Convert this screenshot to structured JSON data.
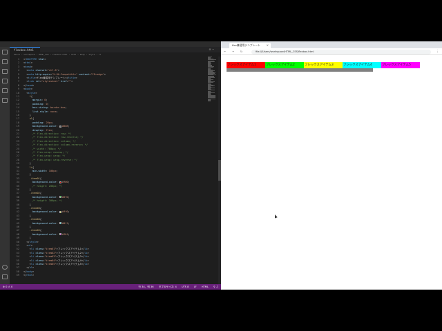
{
  "vscode": {
    "tab_label": "flexbox.html",
    "tab_actions": "⊟ ⋯",
    "breadcrumb": "Users › workspace › HTML_CSS › flexbox.html › html › body › style › li",
    "code_lines": [
      {
        "n": "1",
        "t": [
          [
            "t-pl",
            "<!"
          ],
          [
            "t-tag",
            "DOCTYPE"
          ],
          [
            "t-pl",
            " "
          ],
          [
            "t-attr",
            "html"
          ],
          [
            "t-pl",
            ">"
          ]
        ]
      },
      {
        "n": "2",
        "t": [
          [
            "t-pl",
            "<"
          ],
          [
            "t-tag",
            "html"
          ],
          [
            "t-pl",
            ">"
          ]
        ]
      },
      {
        "n": "3",
        "t": [
          [
            "t-pl",
            "<"
          ],
          [
            "t-tag",
            "head"
          ],
          [
            "t-pl",
            ">"
          ]
        ]
      },
      {
        "n": "4",
        "t": [
          [
            "t-pl",
            "  <"
          ],
          [
            "t-tag",
            "meta"
          ],
          [
            "t-pl",
            " "
          ],
          [
            "t-attr",
            "charset"
          ],
          [
            "t-pl",
            "="
          ],
          [
            "t-str",
            "\"utf-8\""
          ],
          [
            "t-pl",
            ">"
          ]
        ]
      },
      {
        "n": "5",
        "t": [
          [
            "t-pl",
            "  <"
          ],
          [
            "t-tag",
            "meta"
          ],
          [
            "t-pl",
            " "
          ],
          [
            "t-attr",
            "http-equiv"
          ],
          [
            "t-pl",
            "="
          ],
          [
            "t-str",
            "\"X-UA-Compatible\""
          ],
          [
            "t-pl",
            " "
          ],
          [
            "t-attr",
            "content"
          ],
          [
            "t-pl",
            "="
          ],
          [
            "t-str",
            "\"IE=edge\""
          ],
          [
            "t-pl",
            ">"
          ]
        ]
      },
      {
        "n": "6",
        "t": [
          [
            "t-pl",
            "  <"
          ],
          [
            "t-tag",
            "title"
          ],
          [
            "t-pl",
            ">flex練習用テンプレート</"
          ],
          [
            "t-tag",
            "title"
          ],
          [
            "t-pl",
            ">"
          ]
        ]
      },
      {
        "n": "7",
        "t": [
          [
            "t-pl",
            "  <"
          ],
          [
            "t-tag",
            "link"
          ],
          [
            "t-pl",
            " "
          ],
          [
            "t-attr",
            "rel"
          ],
          [
            "t-pl",
            "="
          ],
          [
            "t-str",
            "\"stylesheet\""
          ],
          [
            "t-pl",
            " "
          ],
          [
            "t-attr",
            "href"
          ],
          [
            "t-pl",
            "="
          ],
          [
            "t-str",
            "\"\""
          ],
          [
            "t-pl",
            ">"
          ]
        ]
      },
      {
        "n": "8",
        "t": [
          [
            "t-pl",
            "</"
          ],
          [
            "t-tag",
            "head"
          ],
          [
            "t-pl",
            ">"
          ]
        ]
      },
      {
        "n": "9",
        "t": [
          [
            "t-pl",
            "<"
          ],
          [
            "t-tag",
            "body"
          ],
          [
            "t-pl",
            ">"
          ]
        ]
      },
      {
        "n": "10",
        "t": [
          [
            "t-pl",
            "  <"
          ],
          [
            "t-tag",
            "style"
          ],
          [
            "t-pl",
            ">"
          ]
        ]
      },
      {
        "n": "11",
        "t": [
          [
            "t-sel",
            "    *"
          ],
          [
            "t-pl",
            "{"
          ]
        ]
      },
      {
        "n": "12",
        "t": [
          [
            "t-prop",
            "      margin"
          ],
          [
            "t-pl",
            ": "
          ],
          [
            "t-val",
            "0"
          ],
          [
            "t-pl",
            ";"
          ]
        ]
      },
      {
        "n": "13",
        "t": [
          [
            "t-prop",
            "      padding"
          ],
          [
            "t-pl",
            ": "
          ],
          [
            "t-val",
            "0"
          ],
          [
            "t-pl",
            ";"
          ]
        ]
      },
      {
        "n": "14",
        "t": [
          [
            "t-prop",
            "      box-sizing"
          ],
          [
            "t-pl",
            ": "
          ],
          [
            "t-val",
            "border-box"
          ],
          [
            "t-pl",
            ";"
          ]
        ]
      },
      {
        "n": "15",
        "t": [
          [
            "t-prop",
            "      list-style"
          ],
          [
            "t-pl",
            ": "
          ],
          [
            "t-val",
            "none"
          ],
          [
            "t-pl",
            ";"
          ]
        ]
      },
      {
        "n": "16",
        "t": [
          [
            "t-pl",
            "    }"
          ]
        ]
      },
      {
        "n": "17",
        "t": [
          [
            "t-sel",
            "    ul"
          ],
          [
            "t-pl",
            "{"
          ]
        ]
      },
      {
        "n": "18",
        "t": [
          [
            "t-prop",
            "      padding"
          ],
          [
            "t-pl",
            ": "
          ],
          [
            "t-val",
            "20px"
          ],
          [
            "t-pl",
            ";"
          ]
        ]
      },
      {
        "n": "19",
        "t": [
          [
            "t-prop",
            "      background-color"
          ],
          [
            "t-pl",
            ": "
          ],
          [
            "sw",
            "#808080"
          ],
          [
            "t-val",
            "#808"
          ],
          [
            "t-pl",
            ";"
          ]
        ]
      },
      {
        "n": "20",
        "t": [
          [
            "t-prop",
            "      display"
          ],
          [
            "t-pl",
            ": "
          ],
          [
            "t-val",
            "flex"
          ],
          [
            "t-pl",
            ";"
          ]
        ]
      },
      {
        "n": "21",
        "t": [
          [
            "t-com",
            "      /* flex-direction: row; */"
          ]
        ]
      },
      {
        "n": "22",
        "t": [
          [
            "t-com",
            "      /* flex-direction: row-reverse; */"
          ]
        ]
      },
      {
        "n": "23",
        "t": [
          [
            "t-com",
            "      /* flex-direction: column; */"
          ]
        ]
      },
      {
        "n": "24",
        "t": [
          [
            "t-com",
            "      /* flex-direction: column-reverse; */"
          ]
        ]
      },
      {
        "n": "25",
        "t": [
          [
            "t-com",
            "      /* width: 700px; */"
          ]
        ]
      },
      {
        "n": "26",
        "t": [
          [
            "t-com",
            "      /* flex-wrap: nowrap; */"
          ]
        ]
      },
      {
        "n": "27",
        "t": [
          [
            "t-com",
            "      /* flex-wrap: wrap; */"
          ]
        ]
      },
      {
        "n": "28",
        "t": [
          [
            "t-com",
            "      /* flex-wrap: wrap-reverse; */"
          ]
        ]
      },
      {
        "n": "29",
        "t": [
          [
            "t-pl",
            "    }"
          ]
        ]
      },
      {
        "n": "30",
        "t": [
          [
            "t-sel",
            "    li"
          ],
          [
            "t-pl",
            "{"
          ]
        ]
      },
      {
        "n": "31",
        "t": [
          [
            "t-prop",
            "      min-width"
          ],
          [
            "t-pl",
            ": "
          ],
          [
            "t-val",
            "100px"
          ],
          [
            "t-pl",
            ";"
          ]
        ]
      },
      {
        "n": "32",
        "t": [
          [
            "t-pl",
            "    }"
          ]
        ]
      },
      {
        "n": "33",
        "t": [
          [
            "t-sel",
            "    .item01"
          ],
          [
            "t-pl",
            "{"
          ]
        ]
      },
      {
        "n": "34",
        "t": [
          [
            "t-prop",
            "      background-color"
          ],
          [
            "t-pl",
            ": "
          ],
          [
            "sw",
            "#ff0000"
          ],
          [
            "t-val",
            "#f00"
          ],
          [
            "t-pl",
            ";"
          ]
        ]
      },
      {
        "n": "35",
        "t": [
          [
            "t-com",
            "      /* height: 200px; */"
          ]
        ]
      },
      {
        "n": "36",
        "t": [
          [
            "t-pl",
            "    }"
          ]
        ]
      },
      {
        "n": "37",
        "t": [
          [
            "t-sel",
            "    .item02"
          ],
          [
            "t-pl",
            "{"
          ]
        ]
      },
      {
        "n": "38",
        "t": [
          [
            "t-prop",
            "      background-color"
          ],
          [
            "t-pl",
            ": "
          ],
          [
            "sw",
            "#00ff00"
          ],
          [
            "t-val",
            "#0f0"
          ],
          [
            "t-pl",
            ";"
          ]
        ]
      },
      {
        "n": "39",
        "t": [
          [
            "t-com",
            "      /* height: 300px; */"
          ]
        ]
      },
      {
        "n": "40",
        "t": [
          [
            "t-pl",
            "    }"
          ]
        ]
      },
      {
        "n": "41",
        "t": [
          [
            "t-sel",
            "    .item03"
          ],
          [
            "t-pl",
            "{"
          ]
        ]
      },
      {
        "n": "42",
        "t": [
          [
            "t-prop",
            "      background-color"
          ],
          [
            "t-pl",
            ": "
          ],
          [
            "sw",
            "#ffff00"
          ],
          [
            "t-val",
            "#ff0"
          ],
          [
            "t-pl",
            ";"
          ]
        ]
      },
      {
        "n": "43",
        "t": [
          [
            "t-pl",
            "    }"
          ]
        ]
      },
      {
        "n": "44",
        "t": [
          [
            "t-sel",
            "    .item04"
          ],
          [
            "t-pl",
            "{"
          ]
        ]
      },
      {
        "n": "45",
        "t": [
          [
            "t-prop",
            "      background-color"
          ],
          [
            "t-pl",
            ": "
          ],
          [
            "sw",
            "#00ffff"
          ],
          [
            "t-val",
            "#0ff"
          ],
          [
            "t-pl",
            ";"
          ]
        ]
      },
      {
        "n": "46",
        "t": [
          [
            "t-pl",
            "    }"
          ]
        ]
      },
      {
        "n": "47",
        "t": [
          [
            "t-sel",
            "    .item05"
          ],
          [
            "t-pl",
            "{"
          ]
        ]
      },
      {
        "n": "48",
        "t": [
          [
            "t-prop",
            "      background-color"
          ],
          [
            "t-pl",
            ": "
          ],
          [
            "sw",
            "#ff00ff"
          ],
          [
            "t-val",
            "#f0f"
          ],
          [
            "t-pl",
            ";"
          ]
        ]
      },
      {
        "n": "49",
        "t": [
          [
            "t-pl",
            "    }"
          ]
        ]
      },
      {
        "n": "50",
        "t": [
          [
            "t-pl",
            "  </"
          ],
          [
            "t-tag",
            "style"
          ],
          [
            "t-pl",
            ">"
          ]
        ]
      },
      {
        "n": "51",
        "t": [
          [
            "t-pl",
            "  <"
          ],
          [
            "t-tag",
            "ul"
          ],
          [
            "t-pl",
            ">"
          ]
        ]
      },
      {
        "n": "52",
        "t": [
          [
            "t-pl",
            "    <"
          ],
          [
            "t-tag",
            "li"
          ],
          [
            "t-pl",
            " "
          ],
          [
            "t-attr",
            "class"
          ],
          [
            "t-pl",
            "="
          ],
          [
            "t-str",
            "\"item01\""
          ],
          [
            "t-pl",
            ">フレックスアイテム1</"
          ],
          [
            "t-tag",
            "li"
          ],
          [
            "t-pl",
            ">"
          ]
        ]
      },
      {
        "n": "53",
        "t": [
          [
            "t-pl",
            "    <"
          ],
          [
            "t-tag",
            "li"
          ],
          [
            "t-pl",
            " "
          ],
          [
            "t-attr",
            "class"
          ],
          [
            "t-pl",
            "="
          ],
          [
            "t-str",
            "\"item02\""
          ],
          [
            "t-pl",
            ">フレックスアイテム2</"
          ],
          [
            "t-tag",
            "li"
          ],
          [
            "t-pl",
            ">"
          ]
        ]
      },
      {
        "n": "54",
        "t": [
          [
            "t-pl",
            "    <"
          ],
          [
            "t-tag",
            "li"
          ],
          [
            "t-pl",
            " "
          ],
          [
            "t-attr",
            "class"
          ],
          [
            "t-pl",
            "="
          ],
          [
            "t-str",
            "\"item03\""
          ],
          [
            "t-pl",
            ">フレックスアイテム3</"
          ],
          [
            "t-tag",
            "li"
          ],
          [
            "t-pl",
            ">"
          ]
        ]
      },
      {
        "n": "55",
        "t": [
          [
            "t-pl",
            "    <"
          ],
          [
            "t-tag",
            "li"
          ],
          [
            "t-pl",
            " "
          ],
          [
            "t-attr",
            "class"
          ],
          [
            "t-pl",
            "="
          ],
          [
            "t-str",
            "\"item04\""
          ],
          [
            "t-pl",
            ">フレックスアイテム4</"
          ],
          [
            "t-tag",
            "li"
          ],
          [
            "t-pl",
            ">"
          ]
        ]
      },
      {
        "n": "56",
        "t": [
          [
            "t-pl",
            "    <"
          ],
          [
            "t-tag",
            "li"
          ],
          [
            "t-pl",
            " "
          ],
          [
            "t-attr",
            "class"
          ],
          [
            "t-pl",
            "="
          ],
          [
            "t-str",
            "\"item05\""
          ],
          [
            "t-pl",
            ">フレックスアイテム5</"
          ],
          [
            "t-tag",
            "li"
          ],
          [
            "t-pl",
            ">"
          ]
        ]
      },
      {
        "n": "57",
        "t": [
          [
            "t-pl",
            "  </"
          ],
          [
            "t-tag",
            "ul"
          ],
          [
            "t-pl",
            ">"
          ]
        ]
      },
      {
        "n": "58",
        "t": [
          [
            "t-pl",
            "</"
          ],
          [
            "t-tag",
            "body"
          ],
          [
            "t-pl",
            ">"
          ]
        ]
      },
      {
        "n": "59",
        "t": [
          [
            "t-pl",
            "</"
          ],
          [
            "t-tag",
            "html"
          ],
          [
            "t-pl",
            ">"
          ]
        ]
      }
    ],
    "status": {
      "left": "⊗ 0 ⚠ 0",
      "position": "行 34、列 36",
      "indent": "タブのサイズ: 4",
      "encoding": "UTF-8",
      "eol": "LF",
      "language": "HTML",
      "extras": "⚲ ♫"
    },
    "activity_icons": [
      "explorer-icon",
      "search-icon",
      "source-control-icon",
      "run-debug-icon",
      "extensions-icon",
      "remote-icon"
    ],
    "bottom_icons": [
      "account-icon",
      "settings-gear-icon"
    ]
  },
  "browser": {
    "tab_title": "flex練習用テンプレート",
    "tab_close": "×",
    "nav_back": "←",
    "nav_forward": "→",
    "nav_reload": "↻",
    "url": "file:///Users/workspace/HTML_CSS/flexbox.html",
    "menu": "⋮",
    "list_bg": "#808080",
    "items": [
      {
        "label": "フレックスアイテム1",
        "color": "#ff0000"
      },
      {
        "label": "フレックスアイテム2",
        "color": "#00ff00"
      },
      {
        "label": "フレックスアイテム3",
        "color": "#ffff00"
      },
      {
        "label": "フレックスアイテム4",
        "color": "#00ffff"
      },
      {
        "label": "フレックスアイテム5",
        "color": "#ff00ff"
      }
    ]
  }
}
